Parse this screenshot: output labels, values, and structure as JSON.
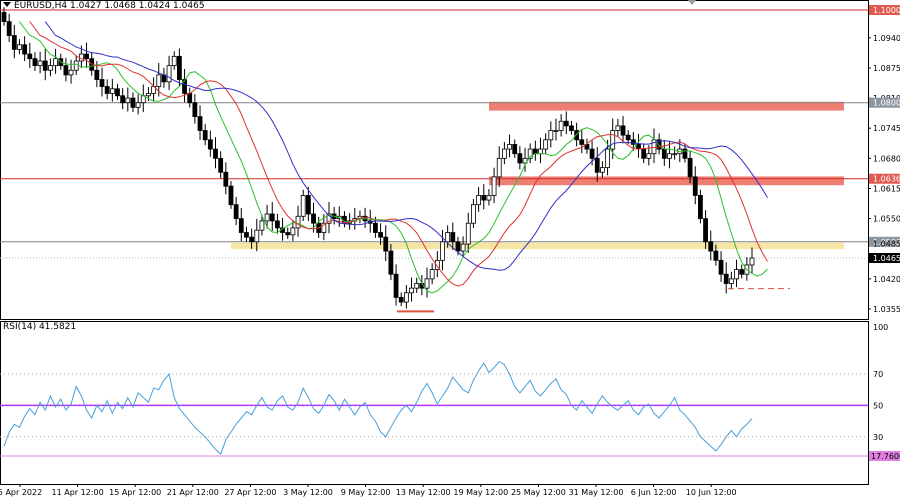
{
  "header": {
    "symbol": "EURUSD,H4",
    "ohlc": "1.0427 1.0468 1.0424 1.0465",
    "rsi_label": "RSI(14) 41.5821"
  },
  "colors": {
    "candle": "#000000",
    "resistance_zone": "#f07f73",
    "support_zone": "#f5e6a5",
    "ma_fast": "#2dbf2d",
    "ma_mid": "#e03030",
    "ma_slow": "#3030c8",
    "rsi_line": "#4a9fd8",
    "rsi_level_50": "#9b30ff",
    "rsi_level_17": "#e080e0",
    "current_price": "#000000",
    "red_marker": "#e05040"
  },
  "chart_data": [
    {
      "type": "candlestick",
      "symbol": "EURUSD",
      "timeframe": "H4",
      "ylim": [
        1.0335,
        1.1015
      ],
      "y_ticks": [
        "1.0940",
        "1.0875",
        "1.0810",
        "1.0745",
        "1.0680",
        "1.0615",
        "1.0550",
        "1.0420",
        "1.0355"
      ],
      "level_labels": [
        {
          "value": 1.1,
          "label": "1.1000",
          "style": "red"
        },
        {
          "value": 1.08,
          "label": "1.0800",
          "style": "gray"
        },
        {
          "value": 1.0636,
          "label": "1.0636",
          "style": "red"
        },
        {
          "value": 1.05,
          "label": "1.0500",
          "style": "gray"
        },
        {
          "value": 1.0485,
          "label": "1.0485",
          "style": "plain"
        },
        {
          "value": 1.0465,
          "label": "1.0465",
          "style": "black"
        }
      ],
      "horizontal_lines": [
        {
          "value": 1.1,
          "color": "red"
        },
        {
          "value": 1.08,
          "color": "gray"
        },
        {
          "value": 1.0636,
          "color": "red"
        },
        {
          "value": 1.05,
          "color": "gray"
        }
      ],
      "zones": [
        {
          "name": "resistance",
          "from": 1.0783,
          "to": 1.0802,
          "start_label": "20 May",
          "color": "red"
        },
        {
          "name": "support",
          "from": 1.0484,
          "to": 1.0498,
          "start_label": "27 Apr",
          "color": "yellow"
        },
        {
          "name": "resistance",
          "from": 1.0622,
          "to": 1.0641,
          "start_label": "20 May",
          "color": "red"
        }
      ],
      "markers": [
        {
          "type": "low",
          "value": 1.035,
          "label_near": "13 May"
        },
        {
          "type": "dashed",
          "value": 1.0399,
          "label_near": "13 Jun"
        }
      ],
      "moving_averages": [
        "fast",
        "mid",
        "slow"
      ],
      "x_tick_labels": [
        "5 Apr 2022",
        "11 Apr 12:00",
        "15 Apr 12:00",
        "21 Apr 12:00",
        "27 Apr 12:00",
        "3 May 12:00",
        "9 May 12:00",
        "13 May 12:00",
        "19 May 12:00",
        "25 May 12:00",
        "31 May 12:00",
        "6 Jun 12:00",
        "10 Jun 12:00"
      ],
      "close_path": [
        1.0975,
        1.0945,
        1.0915,
        1.0925,
        1.0905,
        1.0895,
        1.088,
        1.089,
        1.087,
        1.088,
        1.0895,
        1.088,
        1.086,
        1.087,
        1.089,
        1.0905,
        1.0895,
        1.087,
        1.085,
        1.0835,
        1.082,
        1.083,
        1.0815,
        1.08,
        1.081,
        1.079,
        1.08,
        1.0815,
        1.082,
        1.0835,
        1.086,
        1.0845,
        1.088,
        1.09,
        1.085,
        1.082,
        1.08,
        1.077,
        1.074,
        1.072,
        1.07,
        1.068,
        1.065,
        1.062,
        1.058,
        1.055,
        1.052,
        1.051,
        1.05,
        1.0525,
        1.0545,
        1.056,
        1.0545,
        1.053,
        1.052,
        1.0515,
        1.053,
        1.0555,
        1.06,
        1.056,
        1.054,
        1.052,
        1.054,
        1.056,
        1.055,
        1.0555,
        1.054,
        1.0545,
        1.055,
        1.0555,
        1.0545,
        1.054,
        1.052,
        1.051,
        1.048,
        1.043,
        1.038,
        1.037,
        1.039,
        1.04,
        1.041,
        1.04,
        1.042,
        1.044,
        1.046,
        1.05,
        1.052,
        1.05,
        1.048,
        1.0495,
        1.054,
        1.058,
        1.06,
        1.059,
        1.06,
        1.064,
        1.068,
        1.07,
        1.071,
        1.069,
        1.067,
        1.068,
        1.07,
        1.069,
        1.07,
        1.072,
        1.074,
        1.074,
        1.076,
        1.075,
        1.074,
        1.072,
        1.071,
        1.07,
        1.068,
        1.065,
        1.066,
        1.07,
        1.074,
        1.075,
        1.073,
        1.072,
        1.071,
        1.07,
        1.068,
        1.069,
        1.072,
        1.07,
        1.068,
        1.069,
        1.069,
        1.07,
        1.068,
        1.064,
        1.06,
        1.055,
        1.05,
        1.048,
        1.046,
        1.043,
        1.041,
        1.042,
        1.044,
        1.043,
        1.045,
        1.0465
      ]
    },
    {
      "type": "line",
      "title": "RSI(14) 41.5821",
      "ylim": [
        14,
        105
      ],
      "y_ticks": [
        "100",
        "70",
        "50",
        "30"
      ],
      "levels": [
        {
          "value": 70,
          "style": "dotted"
        },
        {
          "value": 50,
          "style": "solid-purple"
        },
        {
          "value": 30,
          "style": "dotted"
        },
        {
          "value": 17.76,
          "label": "17.7600",
          "style": "solid-pink"
        }
      ],
      "x_tick_labels": [
        "5 Apr 2022",
        "11 Apr 12:00",
        "15 Apr 12:00",
        "21 Apr 12:00",
        "27 Apr 12:00",
        "3 May 12:00",
        "9 May 12:00",
        "13 May 12:00",
        "19 May 12:00",
        "25 May 12:00",
        "31 May 12:00",
        "6 Jun 12:00",
        "10 Jun 12:00"
      ],
      "values": [
        24,
        33,
        38,
        36,
        43,
        48,
        44,
        52,
        47,
        56,
        49,
        54,
        47,
        51,
        62,
        56,
        47,
        42,
        50,
        46,
        53,
        45,
        52,
        48,
        55,
        49,
        58,
        55,
        52,
        61,
        60,
        66,
        70,
        55,
        48,
        44,
        40,
        36,
        33,
        30,
        26,
        22,
        19,
        28,
        33,
        38,
        42,
        46,
        44,
        50,
        55,
        49,
        47,
        53,
        56,
        49,
        47,
        52,
        61,
        55,
        48,
        45,
        50,
        57,
        53,
        47,
        54,
        49,
        44,
        49,
        52,
        44,
        40,
        33,
        30,
        36,
        42,
        47,
        50,
        46,
        52,
        59,
        64,
        58,
        51,
        56,
        61,
        68,
        64,
        60,
        58,
        66,
        72,
        77,
        71,
        74,
        78,
        76,
        70,
        62,
        58,
        62,
        66,
        59,
        56,
        60,
        64,
        67,
        60,
        57,
        50,
        47,
        53,
        49,
        45,
        51,
        56,
        52,
        49,
        47,
        50,
        53,
        47,
        44,
        49,
        51,
        45,
        42,
        46,
        50,
        55,
        47,
        44,
        40,
        36,
        30,
        27,
        24,
        21,
        25,
        30,
        34,
        30,
        35,
        38,
        41.58
      ]
    }
  ]
}
